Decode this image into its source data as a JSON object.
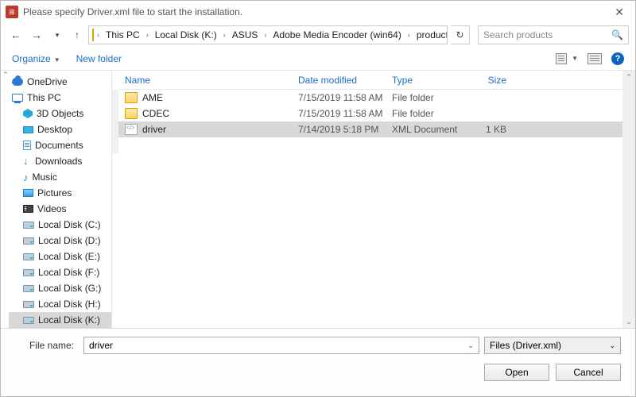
{
  "window": {
    "title": "Please specify Driver.xml file to start the installation.",
    "close": "✕"
  },
  "nav": {
    "back": "←",
    "fwd": "→",
    "dropdown": "▾",
    "up": "↑",
    "refresh": "↻"
  },
  "breadcrumb": [
    "This PC",
    "Local Disk (K:)",
    "ASUS",
    "Adobe Media Encoder (win64)",
    "products"
  ],
  "search": {
    "placeholder": "Search products"
  },
  "toolbar": {
    "organize": "Organize",
    "newfolder": "New folder",
    "help": "?"
  },
  "tree": {
    "items": [
      {
        "label": "OneDrive",
        "icon": "cloud",
        "sub": false
      },
      {
        "label": "This PC",
        "icon": "pc",
        "sub": false
      },
      {
        "label": "3D Objects",
        "icon": "3d",
        "sub": true
      },
      {
        "label": "Desktop",
        "icon": "desktop",
        "sub": true
      },
      {
        "label": "Documents",
        "icon": "doc",
        "sub": true
      },
      {
        "label": "Downloads",
        "icon": "dl",
        "sub": true
      },
      {
        "label": "Music",
        "icon": "music",
        "sub": true
      },
      {
        "label": "Pictures",
        "icon": "pic",
        "sub": true
      },
      {
        "label": "Videos",
        "icon": "vid",
        "sub": true
      },
      {
        "label": "Local Disk (C:)",
        "icon": "drive",
        "sub": true
      },
      {
        "label": "Local Disk (D:)",
        "icon": "drive",
        "sub": true
      },
      {
        "label": "Local Disk (E:)",
        "icon": "drive",
        "sub": true
      },
      {
        "label": "Local Disk (F:)",
        "icon": "drive",
        "sub": true
      },
      {
        "label": "Local Disk (G:)",
        "icon": "drive",
        "sub": true
      },
      {
        "label": "Local Disk (H:)",
        "icon": "drive",
        "sub": true
      },
      {
        "label": "Local Disk (K:)",
        "icon": "drive",
        "sub": true,
        "selected": true
      }
    ]
  },
  "columns": {
    "name": "Name",
    "date": "Date modified",
    "type": "Type",
    "size": "Size"
  },
  "rows": [
    {
      "name": "AME",
      "date": "7/15/2019 11:58 AM",
      "type": "File folder",
      "size": "",
      "icon": "fold"
    },
    {
      "name": "CDEC",
      "date": "7/15/2019 11:58 AM",
      "type": "File folder",
      "size": "",
      "icon": "fold"
    },
    {
      "name": "driver",
      "date": "7/14/2019 5:18 PM",
      "type": "XML Document",
      "size": "1 KB",
      "icon": "xml",
      "selected": true
    }
  ],
  "footer": {
    "filenamelabel": "File name:",
    "filename": "driver",
    "filter": "Files (Driver.xml)",
    "open": "Open",
    "cancel": "Cancel"
  }
}
